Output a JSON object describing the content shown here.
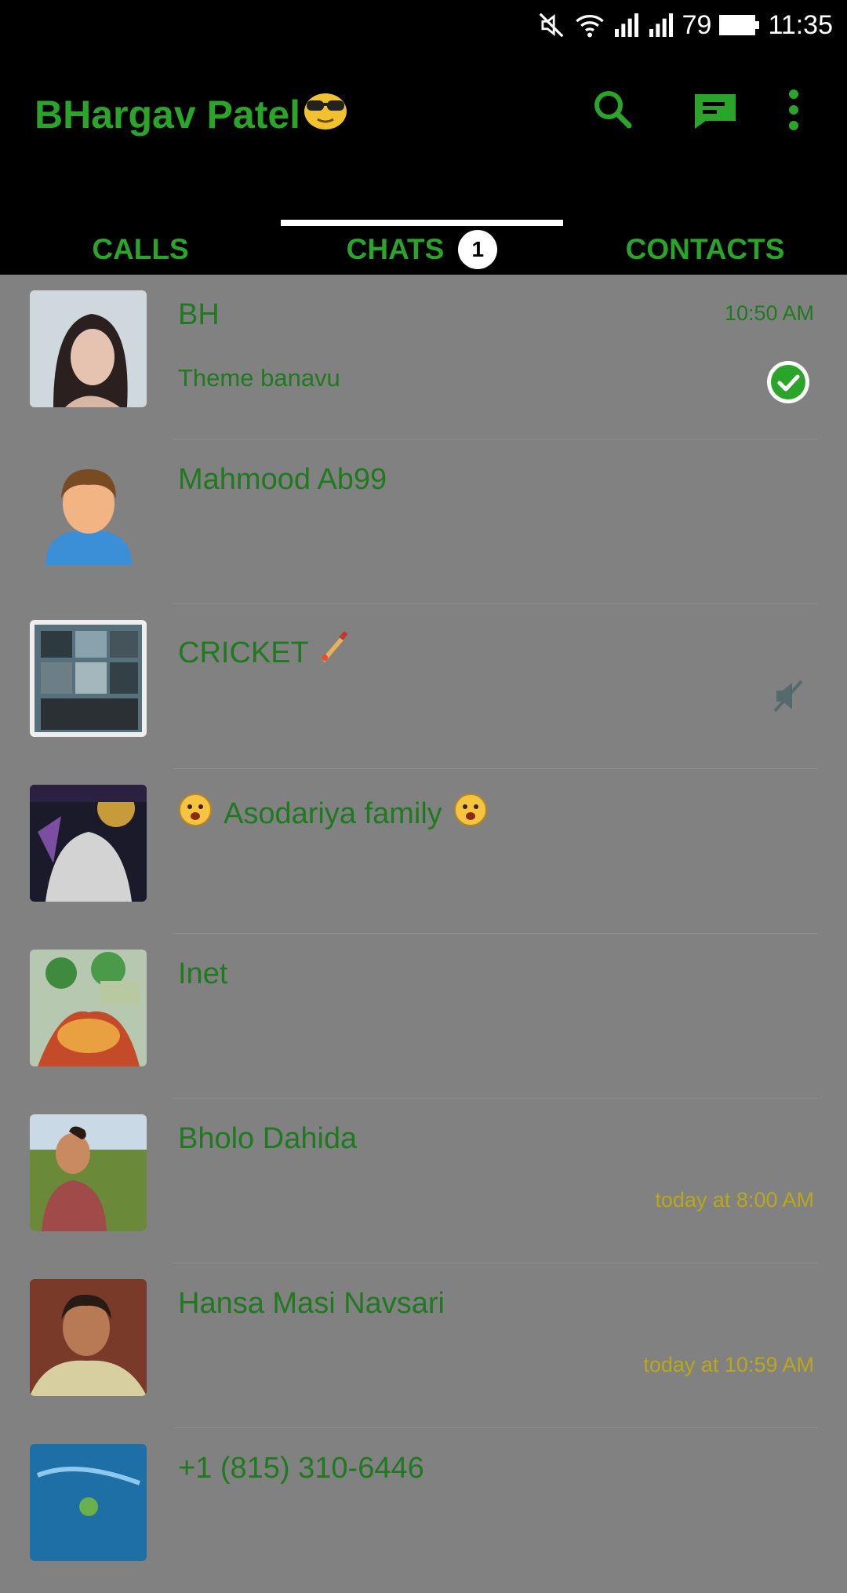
{
  "status_bar": {
    "battery": "79",
    "time": "11:35"
  },
  "app_bar": {
    "title": "BHargav Patel",
    "search_icon": "search-icon",
    "compose_icon": "new-chat-icon",
    "menu_icon": "more-vert-icon"
  },
  "tabs": [
    {
      "label": "CALLS"
    },
    {
      "label": "CHATS",
      "badge": "1"
    },
    {
      "label": "CONTACTS"
    }
  ],
  "chats": [
    {
      "name": "BH",
      "preview": "Theme banavu",
      "time": "10:50 AM",
      "status": "read-check-icon"
    },
    {
      "name": "Mahmood Ab99",
      "preview": "",
      "time": ""
    },
    {
      "name": "CRICKET",
      "preview": "",
      "time": "",
      "muted": true
    },
    {
      "name": "Asodariya family",
      "preview": "",
      "time": ""
    },
    {
      "name": "Inet",
      "preview": "",
      "time": ""
    },
    {
      "name": "Bholo Dahida",
      "preview": "",
      "time": "today at 8:00 AM"
    },
    {
      "name": "Hansa Masi Navsari",
      "preview": "",
      "time": "today at 10:59 AM"
    },
    {
      "name": "+1 (815) 310-6446",
      "preview": "",
      "time": ""
    }
  ],
  "colors": {
    "accent": "#2aa52a",
    "name_text": "#1f7a1f",
    "list_bg": "#818181",
    "time_yellow": "#b8a81a"
  }
}
